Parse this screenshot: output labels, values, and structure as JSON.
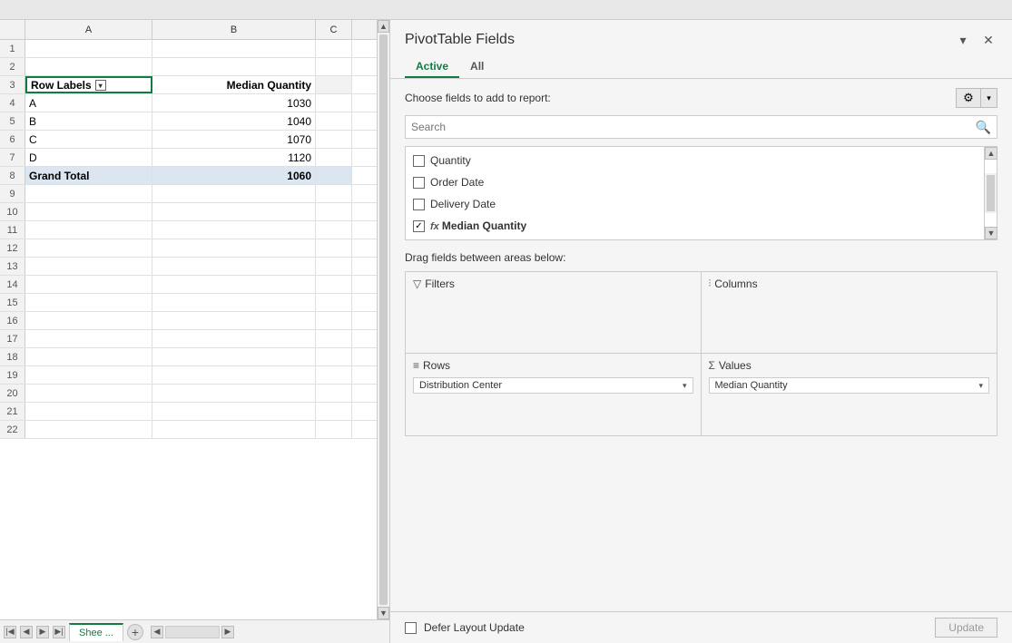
{
  "topbar": {},
  "spreadsheet": {
    "columns": [
      "A",
      "B",
      "C"
    ],
    "rows": [
      {
        "num": 1,
        "a": "",
        "b": "",
        "c": ""
      },
      {
        "num": 2,
        "a": "",
        "b": "",
        "c": ""
      },
      {
        "num": 3,
        "a": "Row Labels",
        "b": "Median Quantity",
        "c": "",
        "isHeader": true
      },
      {
        "num": 4,
        "a": "A",
        "b": "1030",
        "c": ""
      },
      {
        "num": 5,
        "a": "B",
        "b": "1040",
        "c": ""
      },
      {
        "num": 6,
        "a": "C",
        "b": "1070",
        "c": ""
      },
      {
        "num": 7,
        "a": "D",
        "b": "1120",
        "c": ""
      },
      {
        "num": 8,
        "a": "Grand Total",
        "b": "1060",
        "c": "",
        "isGrandTotal": true
      },
      {
        "num": 9,
        "a": "",
        "b": "",
        "c": ""
      },
      {
        "num": 10,
        "a": "",
        "b": "",
        "c": ""
      },
      {
        "num": 11,
        "a": "",
        "b": "",
        "c": ""
      },
      {
        "num": 12,
        "a": "",
        "b": "",
        "c": ""
      },
      {
        "num": 13,
        "a": "",
        "b": "",
        "c": ""
      },
      {
        "num": 14,
        "a": "",
        "b": "",
        "c": ""
      },
      {
        "num": 15,
        "a": "",
        "b": "",
        "c": ""
      },
      {
        "num": 16,
        "a": "",
        "b": "",
        "c": ""
      },
      {
        "num": 17,
        "a": "",
        "b": "",
        "c": ""
      },
      {
        "num": 18,
        "a": "",
        "b": "",
        "c": ""
      },
      {
        "num": 19,
        "a": "",
        "b": "",
        "c": ""
      },
      {
        "num": 20,
        "a": "",
        "b": "",
        "c": ""
      },
      {
        "num": 21,
        "a": "",
        "b": "",
        "c": ""
      },
      {
        "num": 22,
        "a": "",
        "b": "",
        "c": ""
      }
    ],
    "sheet_tab_label": "Shee ...",
    "add_sheet_label": "+"
  },
  "pivot_panel": {
    "title": "PivotTable Fields",
    "tabs": [
      {
        "label": "Active",
        "active": true
      },
      {
        "label": "All",
        "active": false
      }
    ],
    "choose_fields_label": "Choose fields to add to report:",
    "search_placeholder": "Search",
    "fields": [
      {
        "label": "Quantity",
        "checked": false,
        "fx": false
      },
      {
        "label": "Order Date",
        "checked": false,
        "fx": false
      },
      {
        "label": "Delivery Date",
        "checked": false,
        "fx": false
      },
      {
        "label": "Median Quantity",
        "checked": true,
        "fx": true
      }
    ],
    "drag_areas_label": "Drag fields between areas below:",
    "areas": [
      {
        "title": "Filters",
        "icon": "▽",
        "chips": []
      },
      {
        "title": "Columns",
        "icon": "|||",
        "chips": []
      },
      {
        "title": "Rows",
        "icon": "≡",
        "chips": [
          "Distribution Center"
        ]
      },
      {
        "title": "Values",
        "icon": "Σ",
        "chips": [
          "Median Quantity"
        ]
      }
    ],
    "defer_label": "Defer Layout Update",
    "update_label": "Update"
  }
}
